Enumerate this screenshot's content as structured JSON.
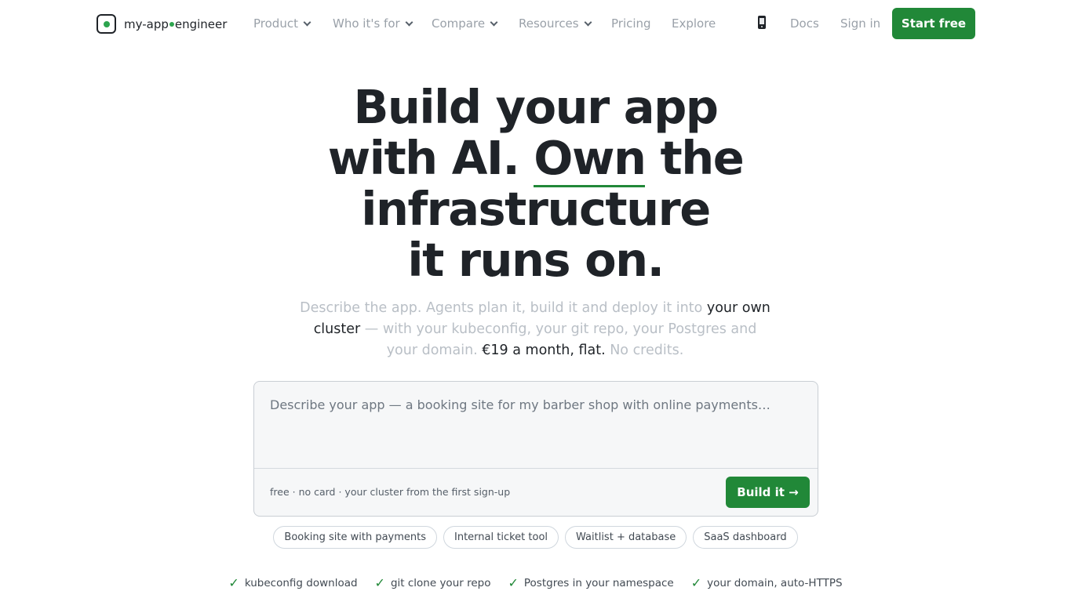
{
  "brand": {
    "name_left": "my-app",
    "name_right": "engineer"
  },
  "nav": {
    "items": [
      {
        "label": "Product",
        "dropdown": true
      },
      {
        "label": "Who it's for",
        "dropdown": true
      },
      {
        "label": "Compare",
        "dropdown": true
      },
      {
        "label": "Resources",
        "dropdown": true
      },
      {
        "label": "Pricing",
        "dropdown": false
      },
      {
        "label": "Explore",
        "dropdown": false
      }
    ],
    "mobile_icon": "phone-icon",
    "docs": "Docs",
    "signin": "Sign in",
    "cta": "Start free"
  },
  "hero": {
    "line1": "Build your app",
    "line2_a": "with AI. ",
    "line2_accent": "Own",
    "line2_b": " the",
    "line3": "infrastructure",
    "line4": "it runs on."
  },
  "subtitle": {
    "part1": "Describe the app. Agents plan it, build it and deploy it into ",
    "part2": "your own cluster",
    "part3": " — with your kubeconfig, your git repo, your Postgres and your domain. ",
    "part4": "€19 a month, flat.",
    "part5": " No credits."
  },
  "prompt": {
    "placeholder": "Describe your app — a booking site for my barber shop with online payments…",
    "value": "",
    "fineprint": "free · no card · your cluster from the first sign-up",
    "button": "Build it →"
  },
  "chips": [
    "Booking site with payments",
    "Internal ticket tool",
    "Waitlist + database",
    "SaaS dashboard"
  ],
  "features": [
    "kubeconfig download",
    "git clone your repo",
    "Postgres in your namespace",
    "your domain, auto-HTTPS"
  ],
  "colors": {
    "accent": "#218838",
    "muted_text": "#9aa1a9",
    "heading": "#1f2328"
  }
}
